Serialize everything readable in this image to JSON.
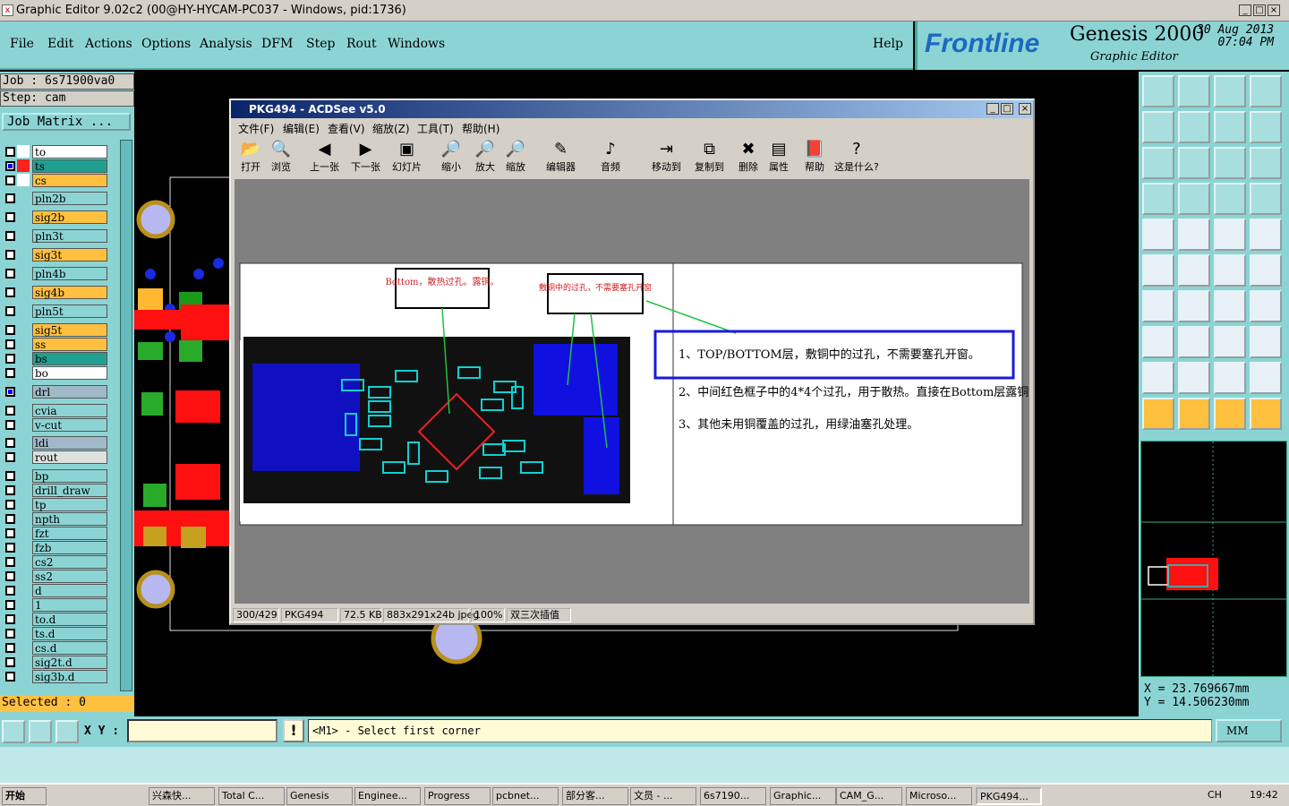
{
  "window": {
    "title": "Graphic Editor 9.02c2 (00@HY-HYCAM-PC037 - Windows, pid:1736)"
  },
  "menu": [
    "File",
    "Edit",
    "Actions",
    "Options",
    "Analysis",
    "DFM",
    "Step",
    "Rout",
    "Windows"
  ],
  "help": "Help",
  "brand": {
    "logo": "Frontline",
    "product": "Genesis 2000",
    "subtitle": "Graphic Editor",
    "date": "30 Aug 2013",
    "time": "07:04 PM"
  },
  "job": {
    "job_label": "Job : 6s71900va0",
    "step_label": "Step: cam",
    "matrix_button": "Job Matrix ..."
  },
  "layers": [
    {
      "name": "to",
      "color": "#ffffff",
      "swatch": "#ffffff",
      "checked": false
    },
    {
      "name": "ts",
      "color": "#20a090",
      "swatch": "#ff2020",
      "checked": true
    },
    {
      "name": "cs",
      "color": "#ffc040",
      "swatch": "#ffffff",
      "checked": false
    },
    {
      "name": "pln2b",
      "color": "#8cd4d4",
      "swatch": "#8cd4d4",
      "checked": false
    },
    {
      "name": "sig2b",
      "color": "#ffc040",
      "swatch": "#8cd4d4",
      "checked": false
    },
    {
      "name": "pln3t",
      "color": "#8cd4d4",
      "swatch": "#8cd4d4",
      "checked": false
    },
    {
      "name": "sig3t",
      "color": "#ffc040",
      "swatch": "#8cd4d4",
      "checked": false
    },
    {
      "name": "pln4b",
      "color": "#8cd4d4",
      "swatch": "#8cd4d4",
      "checked": false
    },
    {
      "name": "sig4b",
      "color": "#ffc040",
      "swatch": "#8cd4d4",
      "checked": false
    },
    {
      "name": "pln5t",
      "color": "#8cd4d4",
      "swatch": "#8cd4d4",
      "checked": false
    },
    {
      "name": "sig5t",
      "color": "#ffc040",
      "swatch": "#8cd4d4",
      "checked": false
    },
    {
      "name": "ss",
      "color": "#ffc040",
      "swatch": "#8cd4d4",
      "checked": false
    },
    {
      "name": "bs",
      "color": "#20a090",
      "swatch": "#8cd4d4",
      "checked": false
    },
    {
      "name": "bo",
      "color": "#ffffff",
      "swatch": "#8cd4d4",
      "checked": false
    },
    {
      "name": "drl",
      "color": "#a0b8c8",
      "swatch": "#8cd4d4",
      "checked": true
    },
    {
      "name": "cvia",
      "color": "#8cd4d4",
      "swatch": "#8cd4d4",
      "checked": false
    },
    {
      "name": "v-cut",
      "color": "#8cd4d4",
      "swatch": "#8cd4d4",
      "checked": false
    },
    {
      "name": "ldi",
      "color": "#a0b8c8",
      "swatch": "#8cd4d4",
      "checked": false
    },
    {
      "name": "rout",
      "color": "#e0e0e0",
      "swatch": "#8cd4d4",
      "checked": false
    },
    {
      "name": "bp",
      "color": "#8cd4d4",
      "swatch": "#8cd4d4",
      "checked": false
    },
    {
      "name": "drill_draw",
      "color": "#8cd4d4",
      "swatch": "#8cd4d4",
      "checked": false
    },
    {
      "name": "tp",
      "color": "#8cd4d4",
      "swatch": "#8cd4d4",
      "checked": false
    },
    {
      "name": "npth",
      "color": "#8cd4d4",
      "swatch": "#8cd4d4",
      "checked": false
    },
    {
      "name": "fzt",
      "color": "#8cd4d4",
      "swatch": "#8cd4d4",
      "checked": false
    },
    {
      "name": "fzb",
      "color": "#8cd4d4",
      "swatch": "#8cd4d4",
      "checked": false
    },
    {
      "name": "cs2",
      "color": "#8cd4d4",
      "swatch": "#8cd4d4",
      "checked": false
    },
    {
      "name": "ss2",
      "color": "#8cd4d4",
      "swatch": "#8cd4d4",
      "checked": false
    },
    {
      "name": "d",
      "color": "#8cd4d4",
      "swatch": "#8cd4d4",
      "checked": false
    },
    {
      "name": "1",
      "color": "#8cd4d4",
      "swatch": "#8cd4d4",
      "checked": false
    },
    {
      "name": "to.d",
      "color": "#8cd4d4",
      "swatch": "#8cd4d4",
      "checked": false
    },
    {
      "name": "ts.d",
      "color": "#8cd4d4",
      "swatch": "#8cd4d4",
      "checked": false
    },
    {
      "name": "cs.d",
      "color": "#8cd4d4",
      "swatch": "#8cd4d4",
      "checked": false
    },
    {
      "name": "sig2t.d",
      "color": "#8cd4d4",
      "swatch": "#8cd4d4",
      "checked": false
    },
    {
      "name": "sig3b.d",
      "color": "#8cd4d4",
      "swatch": "#8cd4d4",
      "checked": false
    }
  ],
  "selected": "Selected : 0",
  "coords": {
    "x": "X = 23.769667mm",
    "y": "Y = 14.506230mm"
  },
  "cmd": {
    "xy_label": "X Y :",
    "prompt": "<M1> - Select first corner",
    "units": "MM"
  },
  "acdsee": {
    "title": "PKG494 - ACDSee v5.0",
    "menu": [
      "文件(F)",
      "编辑(E)",
      "查看(V)",
      "缩放(Z)",
      "工具(T)",
      "帮助(H)"
    ],
    "toolbar": [
      "打开",
      "浏览",
      "上一张",
      "下一张",
      "幻灯片",
      "缩小",
      "放大",
      "缩放",
      "编辑器",
      "音频",
      "移动到",
      "复制到",
      "删除",
      "属性",
      "帮助",
      "这是什么?"
    ],
    "annot1": "Bottom，散热过孔。露铜。",
    "annot2": "敷铜中的过孔，不需要塞孔开窗",
    "notes": [
      "1、TOP/BOTTOM层，敷铜中的过孔，不需要塞孔开窗。",
      "2、中间红色框子中的4*4个过孔，用于散热。直接在Bottom层露铜处理。",
      "3、其他未用铜覆盖的过孔，用绿油塞孔处理。"
    ],
    "status": [
      "300/429",
      "PKG494",
      "72.5 KB",
      "883x291x24b jpeg",
      "100%",
      "双三次插值"
    ]
  },
  "taskbar": {
    "start": "开始",
    "tasks": [
      "兴森快...",
      "Total C...",
      "Genesis",
      "Enginee...",
      "Progress",
      "pcbnet...",
      "部分客...",
      "文员 - ...",
      "6s7190...",
      "Graphic...",
      "CAM_G...",
      "Microso...",
      "PKG494..."
    ],
    "clock": "19:42",
    "tray": "CH"
  }
}
